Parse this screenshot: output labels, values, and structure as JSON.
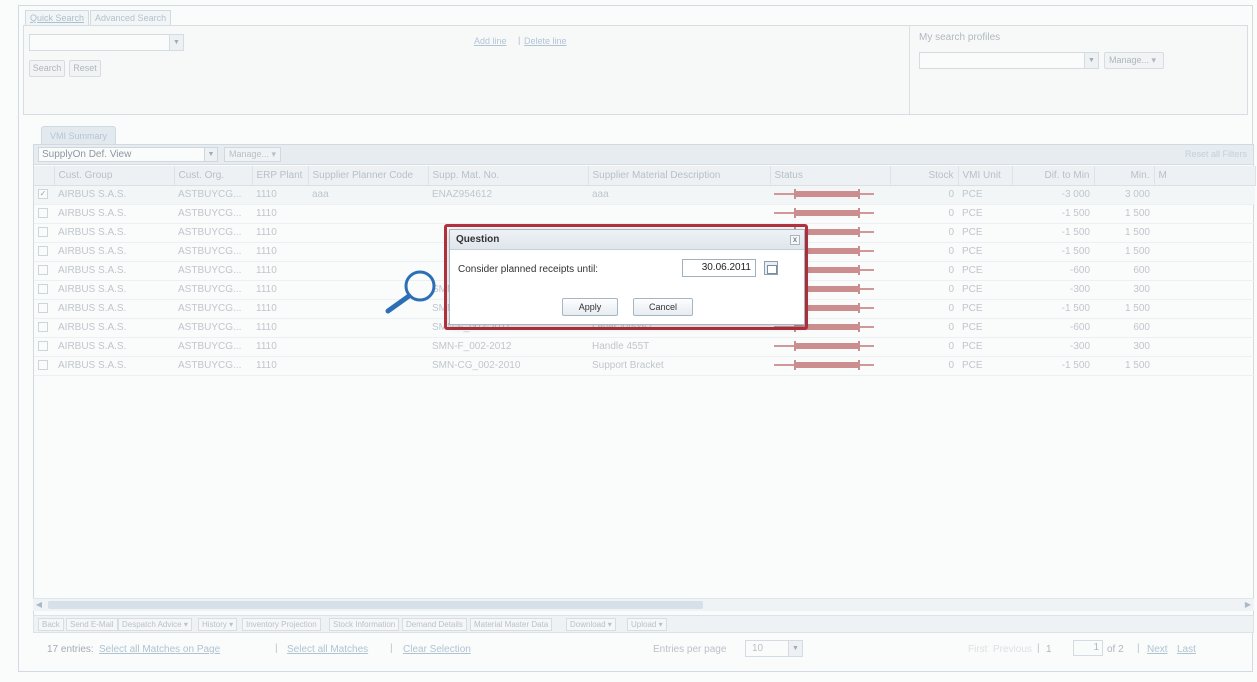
{
  "search_tabs": [
    "Quick Search",
    "Advanced Search"
  ],
  "search_panel": {
    "search_label": "Search",
    "reset_label": "Reset",
    "add_line": "Add line",
    "delete_line": "Delete line",
    "link_separator": "|",
    "profiles_label": "My search profiles",
    "manage_label": "Manage..."
  },
  "grid": {
    "tab_label": "VMI Summary",
    "view": "SupplyOn Def. View",
    "manage_label": "Manage...",
    "reset_filters": "Reset all Filters",
    "columns": [
      "Cust. Group",
      "Cust. Org.",
      "ERP Plant",
      "Supplier Planner Code",
      "Supp. Mat. No.",
      "Supplier Material Description",
      "Status",
      "Stock",
      "VMI Unit",
      "Dif. to Min",
      "Min.",
      "M"
    ],
    "rows": [
      {
        "checked": true,
        "cells": [
          "AIRBUS S.A.S.",
          "ASTBUYCG...",
          "1110",
          "aaa",
          "ENAZ954612",
          "aaa",
          "",
          "0",
          "PCE",
          "-3 000",
          "3 000",
          ""
        ]
      },
      {
        "checked": false,
        "cells": [
          "AIRBUS S.A.S.",
          "ASTBUYCG...",
          "1110",
          "",
          "",
          "",
          "",
          "0",
          "PCE",
          "-1 500",
          "1 500",
          ""
        ]
      },
      {
        "checked": false,
        "cells": [
          "AIRBUS S.A.S.",
          "ASTBUYCG...",
          "1110",
          "",
          "",
          "",
          "",
          "0",
          "PCE",
          "-1 500",
          "1 500",
          ""
        ]
      },
      {
        "checked": false,
        "cells": [
          "AIRBUS S.A.S.",
          "ASTBUYCG...",
          "1110",
          "",
          "",
          "",
          "",
          "0",
          "PCE",
          "-1 500",
          "1 500",
          ""
        ]
      },
      {
        "checked": false,
        "cells": [
          "AIRBUS S.A.S.",
          "ASTBUYCG...",
          "1110",
          "",
          "",
          "",
          "",
          "0",
          "PCE",
          "-600",
          "600",
          ""
        ]
      },
      {
        "checked": false,
        "cells": [
          "AIRBUS S.A.S.",
          "ASTBUYCG...",
          "1110",
          "",
          "SMN-F_002-2012",
          "Handle 455T",
          "",
          "0",
          "PCE",
          "-300",
          "300",
          ""
        ]
      },
      {
        "checked": false,
        "cells": [
          "AIRBUS S.A.S.",
          "ASTBUYCG...",
          "1110",
          "",
          "SMN-F_002-2010",
          "Support Bracket",
          "",
          "0",
          "PCE",
          "-1 500",
          "1 500",
          ""
        ]
      },
      {
        "checked": false,
        "cells": [
          "AIRBUS S.A.S.",
          "ASTBUYCG...",
          "1110",
          "",
          "SMN-F_002-2011",
          "Lever 445x67",
          "",
          "0",
          "PCE",
          "-600",
          "600",
          ""
        ]
      },
      {
        "checked": false,
        "cells": [
          "AIRBUS S.A.S.",
          "ASTBUYCG...",
          "1110",
          "",
          "SMN-F_002-2012",
          "Handle 455T",
          "",
          "0",
          "PCE",
          "-300",
          "300",
          ""
        ]
      },
      {
        "checked": false,
        "cells": [
          "AIRBUS S.A.S.",
          "ASTBUYCG...",
          "1110",
          "",
          "SMN-CG_002-2010",
          "Support Bracket",
          "",
          "0",
          "PCE",
          "-1 500",
          "1 500",
          ""
        ]
      }
    ]
  },
  "actions": [
    "Back",
    "Send E-Mail",
    "Despatch Advice",
    "History",
    "Inventory Projection",
    "Stock Information",
    "Demand Details",
    "Material Master Data",
    "Download",
    "Upload"
  ],
  "footer": {
    "entries": "17 entries:",
    "select_page": "Select all Matches on Page",
    "select_all": "Select all Matches",
    "clear": "Clear Selection",
    "link_separator": "|",
    "entries_per_page_label": "Entries per page",
    "entries_per_page": "10",
    "first": "First",
    "previous": "Previous",
    "page_label": "Page",
    "page": "1",
    "of": "of 2",
    "next": "Next",
    "last": "Last"
  },
  "dialog": {
    "title": "Question",
    "close": "x",
    "label": "Consider planned receipts until:",
    "date": "30.06.2011",
    "apply": "Apply",
    "cancel": "Cancel"
  },
  "colors": {
    "highlight": "#b3323f",
    "status_bar": "#c06d6d",
    "link": "#9db4ca"
  }
}
